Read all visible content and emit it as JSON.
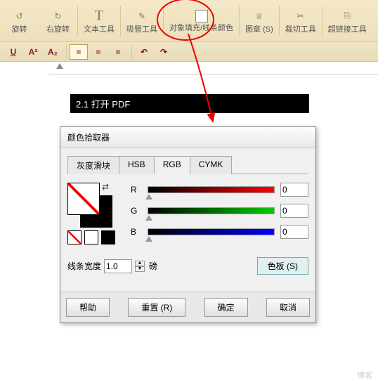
{
  "toolbar": {
    "items": [
      {
        "icon": "↺",
        "label": "旋转"
      },
      {
        "icon": "↻",
        "label": "右旋转"
      },
      {
        "icon": "T",
        "label": "文本工具"
      },
      {
        "icon": "✎",
        "label": "吸管工具"
      },
      {
        "icon": "□",
        "label": "对象填充/线条颜色"
      },
      {
        "icon": "♕",
        "label": "图章 (S)",
        "dropdown": true
      },
      {
        "icon": "✂",
        "label": "裁切工具"
      },
      {
        "icon": "⎘",
        "label": "超链接工具"
      }
    ]
  },
  "subbar": {
    "underline": "U",
    "super": "A²",
    "sub": "A₂",
    "undo": "↶",
    "redo": "↷"
  },
  "doc": {
    "heading": "2.1 打开 PDF"
  },
  "dialog": {
    "title": "颜色拾取器",
    "tabs": [
      "灰度滑块",
      "HSB",
      "RGB",
      "CYMK"
    ],
    "active_tab": "RGB",
    "rgb": {
      "R": "R",
      "G": "G",
      "B": "B",
      "r_val": "0",
      "g_val": "0",
      "b_val": "0"
    },
    "line_width_label": "线条宽度",
    "line_width_value": "1.0",
    "line_width_unit": "磅",
    "palette_btn": "色板 (S)",
    "buttons": {
      "help": "帮助",
      "reset": "重置 (R)",
      "ok": "确定",
      "cancel": "取消"
    }
  },
  "watermark": "博客"
}
